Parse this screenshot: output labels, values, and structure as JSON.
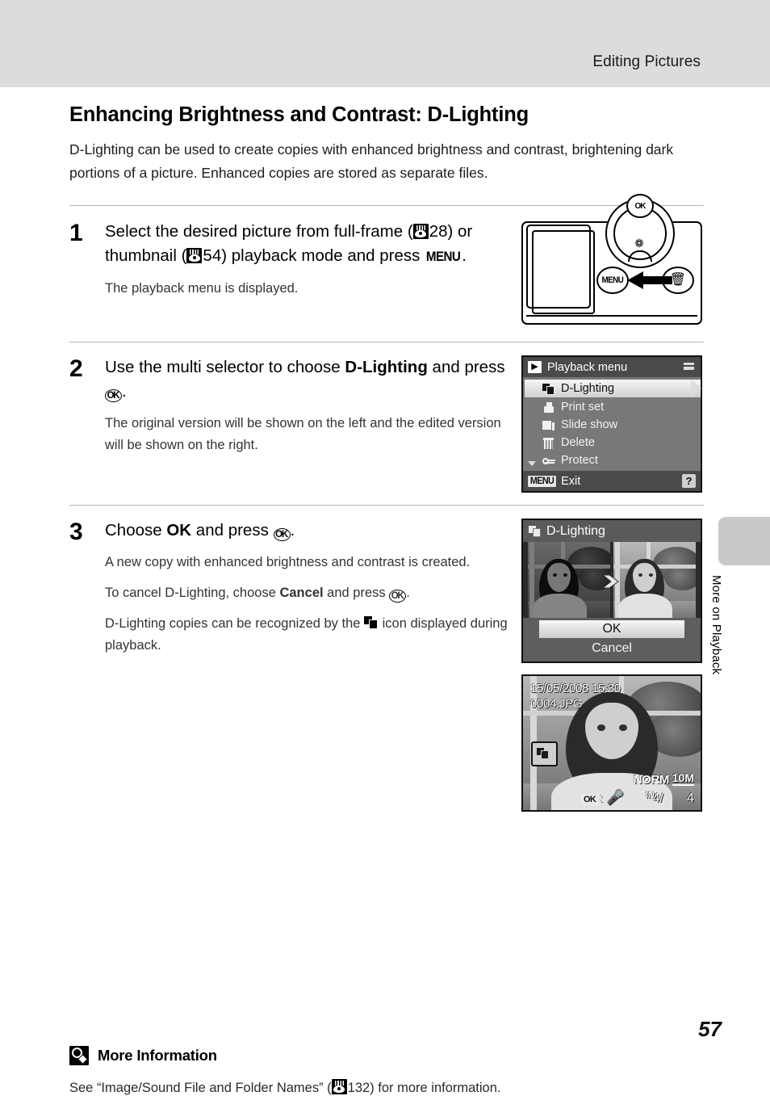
{
  "header": {
    "section_title": "Editing Pictures"
  },
  "side_tab": {
    "label": "More on Playback"
  },
  "page": {
    "heading": "Enhancing Brightness and Contrast: D-Lighting",
    "intro": "D-Lighting can be used to create copies with enhanced brightness and contrast, brightening dark portions of a picture. Enhanced copies are stored as separate files.",
    "number": "57"
  },
  "steps": [
    {
      "number": "1",
      "lead_part1": "Select the desired picture from full-frame (",
      "ref1_page": "28",
      "lead_part2": ") or thumbnail (",
      "ref2_page": "54",
      "lead_part3": ") playback mode and press ",
      "menu_label": "MENU",
      "lead_end": ".",
      "sub": "The playback menu is displayed."
    },
    {
      "number": "2",
      "lead_part1": "Use the multi selector to choose ",
      "lead_bold": "D-Lighting",
      "lead_part2": " and press ",
      "ok_label": "OK",
      "lead_end": ".",
      "sub": "The original version will be shown on the left and the edited version will be shown on the right."
    },
    {
      "number": "3",
      "lead_part1": "Choose ",
      "lead_bold": "OK",
      "lead_part2": " and press ",
      "ok_label": "OK",
      "lead_end": ".",
      "sub1": "A new copy with enhanced brightness and contrast is created.",
      "sub2_part1": "To cancel D-Lighting, choose ",
      "sub2_bold": "Cancel",
      "sub2_part2": " and press ",
      "sub2_ok": "OK",
      "sub2_end": ".",
      "sub3_part1": "D-Lighting copies can be recognized by the ",
      "sub3_part2": " icon displayed during playback."
    }
  ],
  "camera_figure": {
    "menu_button_label": "MENU",
    "ok_dial_label": "OK",
    "macro_icon": "❁",
    "delete_icon": "Ὕ1"
  },
  "playback_menu_screen": {
    "title": "Playback menu",
    "play_icon_glyph": "▶",
    "items": [
      {
        "label": "D-Lighting",
        "icon": "d-lighting-icon",
        "selected": true
      },
      {
        "label": "Print set",
        "icon": "print-icon",
        "selected": false
      },
      {
        "label": "Slide show",
        "icon": "slide-show-icon",
        "selected": false
      },
      {
        "label": "Delete",
        "icon": "trash-icon",
        "selected": false
      },
      {
        "label": "Protect",
        "icon": "key-icon",
        "selected": false
      }
    ],
    "footer_chip": "MENU",
    "footer_label": "Exit",
    "help_glyph": "?"
  },
  "dlighting_screen": {
    "title": "D-Lighting",
    "buttons": [
      {
        "label": "OK",
        "selected": true
      },
      {
        "label": "Cancel",
        "selected": false
      }
    ]
  },
  "playback_screen": {
    "date": "15/05/2008 15:30",
    "filename": "0004.JPG",
    "quality": "NORM",
    "image_size": "10M",
    "ok_chip": "OK",
    "colon": ":",
    "mic_glyph": "Ἲ4",
    "memory_label": "IN",
    "current_index": "4/",
    "total_count": "4"
  },
  "more_information": {
    "title": "More Information",
    "text_part1": "See “Image/Sound File and Folder Names” (",
    "ref_page": "132",
    "text_part2": ") for more information."
  },
  "colors": {
    "header_band": "#dcdcdc",
    "side_tab": "#c9c9c9",
    "separator": "#b5b5b5",
    "lcd_body": "#6e6e6e",
    "lcd_bar": "#4a4a4a"
  }
}
